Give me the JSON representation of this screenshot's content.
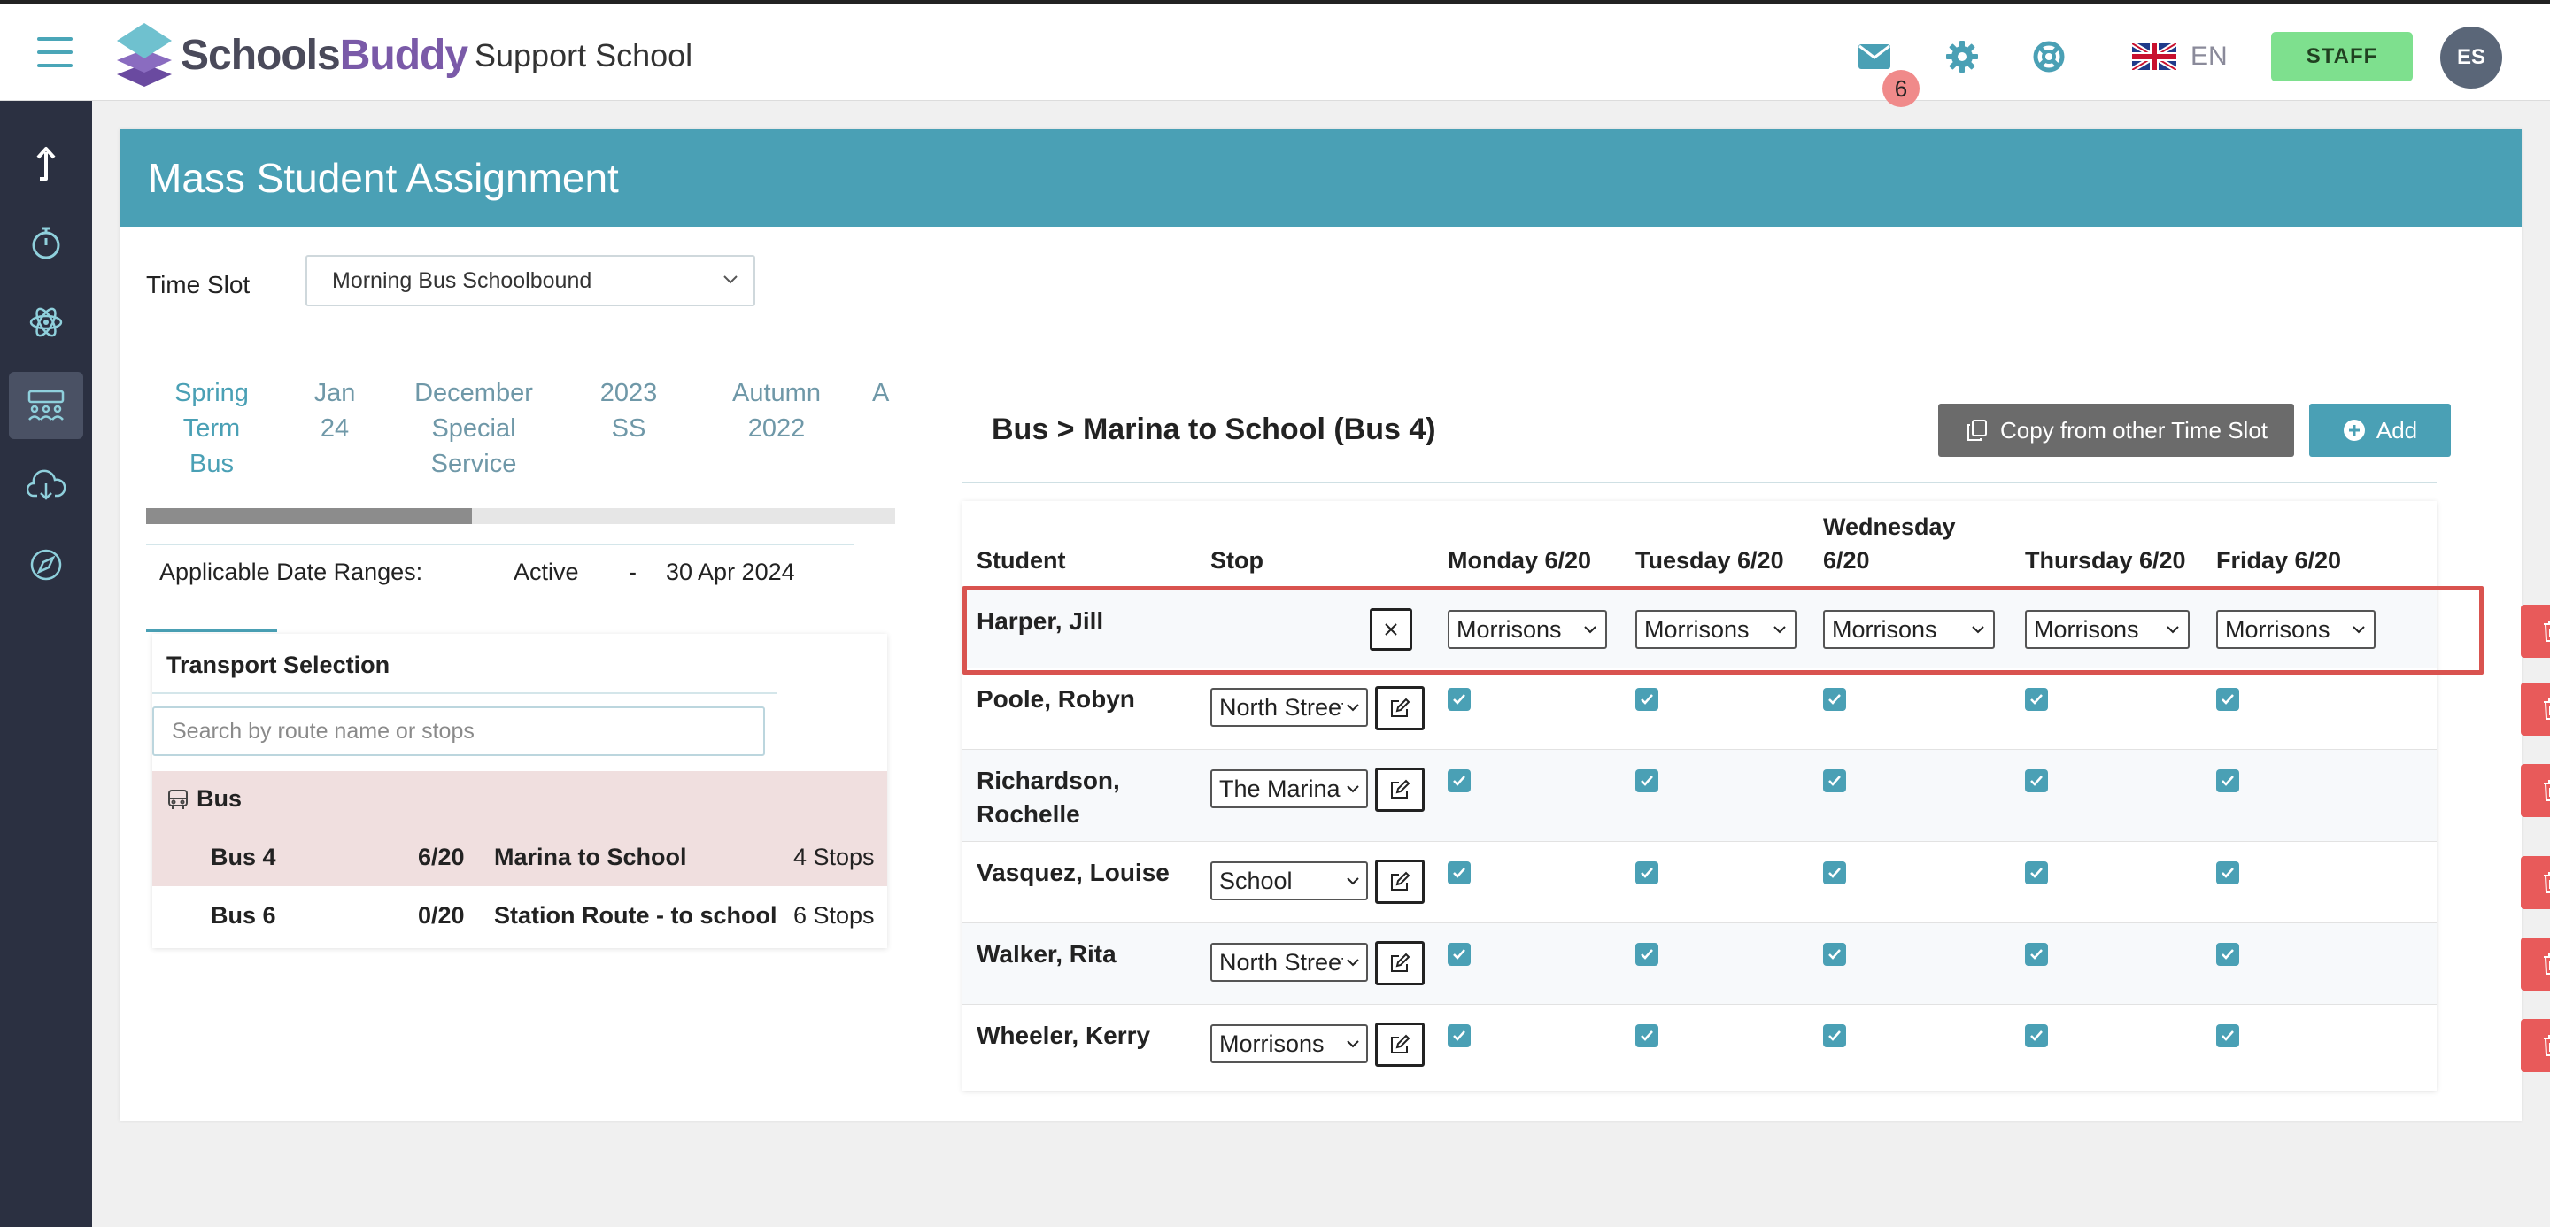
{
  "app": {
    "brand_part1": "Schools",
    "brand_part2": "Buddy",
    "school_name": "Support School",
    "notification_count": "6",
    "language": "EN",
    "role_button": "STAFF",
    "avatar_initials": "ES"
  },
  "colors": {
    "accent": "#4aa0b5",
    "sidebar": "#2b3041",
    "staff": "#7ee08e",
    "danger": "#e85a5a",
    "brand_purple": "#7a5aa8"
  },
  "sidebar": {
    "items": [
      {
        "icon": "arrow-up-icon"
      },
      {
        "icon": "stopwatch-icon"
      },
      {
        "icon": "atom-icon"
      },
      {
        "icon": "bus-seats-icon",
        "active": true
      },
      {
        "icon": "cloud-download-icon"
      },
      {
        "icon": "compass-icon"
      }
    ]
  },
  "page": {
    "title": "Mass Student Assignment",
    "time_slot_label": "Time Slot",
    "time_slot_value": "Morning Bus Schoolbound"
  },
  "tabs": [
    {
      "line1": "Spring",
      "line2": "Term",
      "line3": "Bus",
      "active": true
    },
    {
      "line1": "Jan",
      "line2": "24",
      "line3": ""
    },
    {
      "line1": "December",
      "line2": "Special",
      "line3": "Service"
    },
    {
      "line1": "2023",
      "line2": "SS",
      "line3": ""
    },
    {
      "line1": "Autumn",
      "line2": "2022",
      "line3": ""
    },
    {
      "line1": "A",
      "line2": "",
      "line3": ""
    }
  ],
  "date_ranges": {
    "label": "Applicable Date Ranges:",
    "status": "Active",
    "separator": "-",
    "end": "30 Apr 2024"
  },
  "transport": {
    "title": "Transport Selection",
    "search_placeholder": "Search by route name or stops",
    "group": "Bus",
    "routes": [
      {
        "bus": "Bus 4",
        "capacity": "6/20",
        "name": "Marina to School",
        "stops": "4 Stops",
        "selected": true
      },
      {
        "bus": "Bus 6",
        "capacity": "0/20",
        "name": "Station Route - to school",
        "stops": "6 Stops",
        "selected": false
      }
    ]
  },
  "panel": {
    "route_title": "Bus > Marina to School (Bus 4)",
    "copy_label": "Copy from other Time Slot",
    "add_label": "Add"
  },
  "table": {
    "headers": {
      "student": "Student",
      "stop": "Stop",
      "monday": "Monday 6/20",
      "tuesday": "Tuesday 6/20",
      "wednesday_l1": "Wednesday",
      "wednesday_l2": "6/20",
      "thursday": "Thursday 6/20",
      "friday": "Friday 6/20"
    },
    "new_row": {
      "student": "Harper, Jill",
      "monday": "Morrisons",
      "tuesday": "Morrisons",
      "wednesday": "Morrisons",
      "thursday": "Morrisons",
      "friday": "Morrisons"
    },
    "rows": [
      {
        "student_l1": "Poole, Robyn",
        "student_l2": "",
        "stop": "North Street"
      },
      {
        "student_l1": "Richardson,",
        "student_l2": "Rochelle",
        "stop": "The Marina"
      },
      {
        "student_l1": "Vasquez, Louise",
        "student_l2": "",
        "stop": "School"
      },
      {
        "student_l1": "Walker, Rita",
        "student_l2": "",
        "stop": "North Street"
      },
      {
        "student_l1": "Wheeler, Kerry",
        "student_l2": "",
        "stop": "Morrisons"
      }
    ]
  }
}
